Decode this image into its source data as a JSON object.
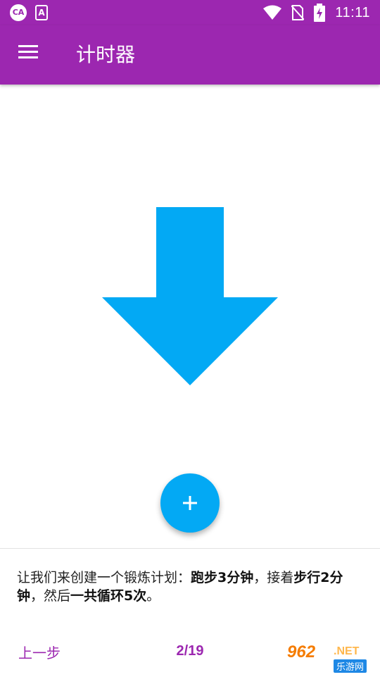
{
  "status_bar": {
    "time": "11:11",
    "app_icon_text": "CA",
    "a_icon_text": "A",
    "icons": [
      "app-notification-icon",
      "a-notification-icon",
      "wifi-icon",
      "no-sim-icon",
      "battery-charging-icon"
    ]
  },
  "app_bar": {
    "title": "计时器",
    "menu_icon": "menu-icon"
  },
  "main": {
    "hint_icon": "arrow-down-icon",
    "fab_icon": "add-icon"
  },
  "tutorial": {
    "text_part1": "让我们来创建一个锻炼计划：",
    "text_bold1": "跑步3分钟",
    "text_part2": "，接着",
    "text_bold2": "步行2分钟",
    "text_part3": "，然后",
    "text_bold3": "一共循环5次",
    "text_part4": "。",
    "prev_label": "上一步",
    "page_indicator": "2/19"
  },
  "watermark": {
    "main": "962",
    "suffix": ".NET",
    "sub": "乐游网"
  },
  "colors": {
    "primary": "#9c27b0",
    "accent": "#03a9f4"
  }
}
